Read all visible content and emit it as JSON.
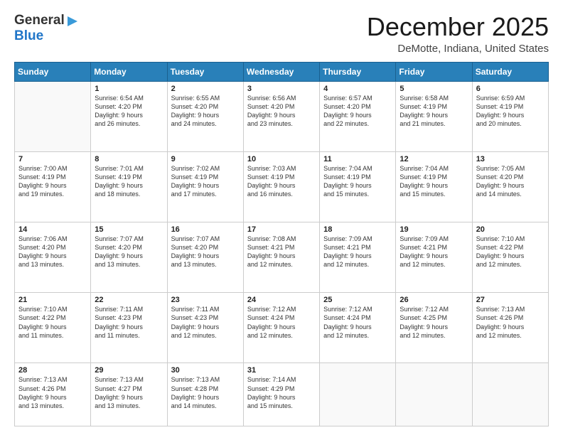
{
  "header": {
    "logo_general": "General",
    "logo_blue": "Blue",
    "title": "December 2025",
    "subtitle": "DeMotte, Indiana, United States"
  },
  "calendar": {
    "days_of_week": [
      "Sunday",
      "Monday",
      "Tuesday",
      "Wednesday",
      "Thursday",
      "Friday",
      "Saturday"
    ],
    "weeks": [
      [
        {
          "num": "",
          "info": ""
        },
        {
          "num": "1",
          "info": "Sunrise: 6:54 AM\nSunset: 4:20 PM\nDaylight: 9 hours\nand 26 minutes."
        },
        {
          "num": "2",
          "info": "Sunrise: 6:55 AM\nSunset: 4:20 PM\nDaylight: 9 hours\nand 24 minutes."
        },
        {
          "num": "3",
          "info": "Sunrise: 6:56 AM\nSunset: 4:20 PM\nDaylight: 9 hours\nand 23 minutes."
        },
        {
          "num": "4",
          "info": "Sunrise: 6:57 AM\nSunset: 4:20 PM\nDaylight: 9 hours\nand 22 minutes."
        },
        {
          "num": "5",
          "info": "Sunrise: 6:58 AM\nSunset: 4:19 PM\nDaylight: 9 hours\nand 21 minutes."
        },
        {
          "num": "6",
          "info": "Sunrise: 6:59 AM\nSunset: 4:19 PM\nDaylight: 9 hours\nand 20 minutes."
        }
      ],
      [
        {
          "num": "7",
          "info": "Sunrise: 7:00 AM\nSunset: 4:19 PM\nDaylight: 9 hours\nand 19 minutes."
        },
        {
          "num": "8",
          "info": "Sunrise: 7:01 AM\nSunset: 4:19 PM\nDaylight: 9 hours\nand 18 minutes."
        },
        {
          "num": "9",
          "info": "Sunrise: 7:02 AM\nSunset: 4:19 PM\nDaylight: 9 hours\nand 17 minutes."
        },
        {
          "num": "10",
          "info": "Sunrise: 7:03 AM\nSunset: 4:19 PM\nDaylight: 9 hours\nand 16 minutes."
        },
        {
          "num": "11",
          "info": "Sunrise: 7:04 AM\nSunset: 4:19 PM\nDaylight: 9 hours\nand 15 minutes."
        },
        {
          "num": "12",
          "info": "Sunrise: 7:04 AM\nSunset: 4:19 PM\nDaylight: 9 hours\nand 15 minutes."
        },
        {
          "num": "13",
          "info": "Sunrise: 7:05 AM\nSunset: 4:20 PM\nDaylight: 9 hours\nand 14 minutes."
        }
      ],
      [
        {
          "num": "14",
          "info": "Sunrise: 7:06 AM\nSunset: 4:20 PM\nDaylight: 9 hours\nand 13 minutes."
        },
        {
          "num": "15",
          "info": "Sunrise: 7:07 AM\nSunset: 4:20 PM\nDaylight: 9 hours\nand 13 minutes."
        },
        {
          "num": "16",
          "info": "Sunrise: 7:07 AM\nSunset: 4:20 PM\nDaylight: 9 hours\nand 13 minutes."
        },
        {
          "num": "17",
          "info": "Sunrise: 7:08 AM\nSunset: 4:21 PM\nDaylight: 9 hours\nand 12 minutes."
        },
        {
          "num": "18",
          "info": "Sunrise: 7:09 AM\nSunset: 4:21 PM\nDaylight: 9 hours\nand 12 minutes."
        },
        {
          "num": "19",
          "info": "Sunrise: 7:09 AM\nSunset: 4:21 PM\nDaylight: 9 hours\nand 12 minutes."
        },
        {
          "num": "20",
          "info": "Sunrise: 7:10 AM\nSunset: 4:22 PM\nDaylight: 9 hours\nand 12 minutes."
        }
      ],
      [
        {
          "num": "21",
          "info": "Sunrise: 7:10 AM\nSunset: 4:22 PM\nDaylight: 9 hours\nand 11 minutes."
        },
        {
          "num": "22",
          "info": "Sunrise: 7:11 AM\nSunset: 4:23 PM\nDaylight: 9 hours\nand 11 minutes."
        },
        {
          "num": "23",
          "info": "Sunrise: 7:11 AM\nSunset: 4:23 PM\nDaylight: 9 hours\nand 12 minutes."
        },
        {
          "num": "24",
          "info": "Sunrise: 7:12 AM\nSunset: 4:24 PM\nDaylight: 9 hours\nand 12 minutes."
        },
        {
          "num": "25",
          "info": "Sunrise: 7:12 AM\nSunset: 4:24 PM\nDaylight: 9 hours\nand 12 minutes."
        },
        {
          "num": "26",
          "info": "Sunrise: 7:12 AM\nSunset: 4:25 PM\nDaylight: 9 hours\nand 12 minutes."
        },
        {
          "num": "27",
          "info": "Sunrise: 7:13 AM\nSunset: 4:26 PM\nDaylight: 9 hours\nand 12 minutes."
        }
      ],
      [
        {
          "num": "28",
          "info": "Sunrise: 7:13 AM\nSunset: 4:26 PM\nDaylight: 9 hours\nand 13 minutes."
        },
        {
          "num": "29",
          "info": "Sunrise: 7:13 AM\nSunset: 4:27 PM\nDaylight: 9 hours\nand 13 minutes."
        },
        {
          "num": "30",
          "info": "Sunrise: 7:13 AM\nSunset: 4:28 PM\nDaylight: 9 hours\nand 14 minutes."
        },
        {
          "num": "31",
          "info": "Sunrise: 7:14 AM\nSunset: 4:29 PM\nDaylight: 9 hours\nand 15 minutes."
        },
        {
          "num": "",
          "info": ""
        },
        {
          "num": "",
          "info": ""
        },
        {
          "num": "",
          "info": ""
        }
      ]
    ]
  }
}
